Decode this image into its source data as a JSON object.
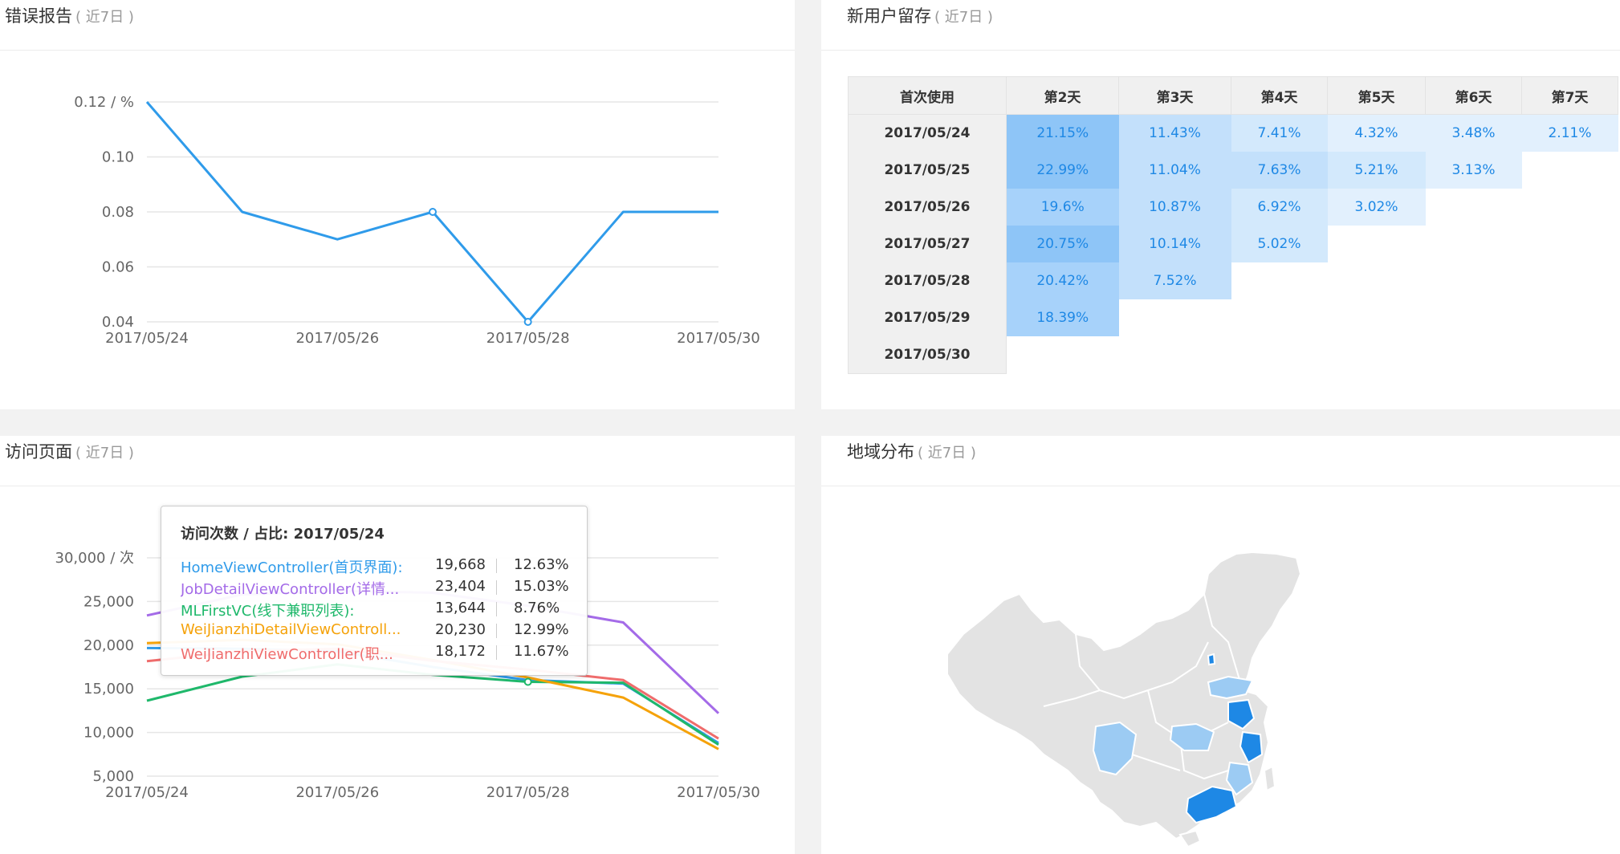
{
  "panels": {
    "error": {
      "title": "错误报告",
      "subtitle": "( 近7日 )"
    },
    "retention": {
      "title": "新用户留存",
      "subtitle": "( 近7日 )"
    },
    "visits": {
      "title": "访问页面",
      "subtitle": "( 近7日 )"
    },
    "region": {
      "title": "地域分布",
      "subtitle": "( 近7日 )"
    }
  },
  "chart_data": [
    {
      "type": "line",
      "title": "错误报告",
      "x": [
        "2017/05/24",
        "2017/05/25",
        "2017/05/26",
        "2017/05/27",
        "2017/05/28",
        "2017/05/29",
        "2017/05/30"
      ],
      "x_tick_labels": [
        "2017/05/24",
        "2017/05/26",
        "2017/05/28",
        "2017/05/30"
      ],
      "series": [
        {
          "values": [
            0.12,
            0.08,
            0.07,
            0.08,
            0.04,
            0.08,
            0.08
          ],
          "color": "#2f9bea"
        }
      ],
      "y_tick_labels": [
        "0.12 / %",
        "0.10",
        "0.08",
        "0.06",
        "0.04"
      ],
      "ylim": [
        0.04,
        0.12
      ],
      "grid": true
    },
    {
      "type": "line",
      "title": "访问页面",
      "x": [
        "2017/05/24",
        "2017/05/25",
        "2017/05/26",
        "2017/05/27",
        "2017/05/28",
        "2017/05/29",
        "2017/05/30"
      ],
      "x_tick_labels": [
        "2017/05/24",
        "2017/05/26",
        "2017/05/28",
        "2017/05/30"
      ],
      "y_tick_labels": [
        "30,000 / 次",
        "25,000",
        "20,000",
        "15,000",
        "10,000",
        "5,000"
      ],
      "ylim": [
        5000,
        30000
      ],
      "grid": true,
      "series": [
        {
          "name": "HomeViewController(首页界面)",
          "color": "#2f9bea",
          "values": [
            19668,
            19600,
            19300,
            17500,
            16000,
            15600,
            8800
          ]
        },
        {
          "name": "JobDetailViewController(详情...",
          "color": "#a46be8",
          "values": [
            23404,
            25800,
            26200,
            26000,
            24500,
            22600,
            12200
          ]
        },
        {
          "name": "MLFirstVC(线下兼职列表)",
          "color": "#1fb86b",
          "values": [
            13644,
            16400,
            17800,
            16600,
            15800,
            15700,
            8600
          ]
        },
        {
          "name": "WeiJianzhiDetailViewControll...",
          "color": "#f5a20a",
          "values": [
            20230,
            20600,
            20100,
            18300,
            16300,
            14000,
            8100
          ]
        },
        {
          "name": "WeiJianzhiViewController(职...",
          "color": "#ef6c6c",
          "values": [
            18172,
            19300,
            19600,
            18200,
            17200,
            16000,
            9300
          ]
        }
      ]
    }
  ],
  "retention": {
    "headers": [
      "首次使用",
      "第2天",
      "第3天",
      "第4天",
      "第5天",
      "第6天",
      "第7天"
    ],
    "rows": [
      {
        "date": "2017/05/24",
        "values": [
          "21.15%",
          "11.43%",
          "7.41%",
          "4.32%",
          "3.48%",
          "2.11%"
        ]
      },
      {
        "date": "2017/05/25",
        "values": [
          "22.99%",
          "11.04%",
          "7.63%",
          "5.21%",
          "3.13%"
        ]
      },
      {
        "date": "2017/05/26",
        "values": [
          "19.6%",
          "10.87%",
          "6.92%",
          "3.02%"
        ]
      },
      {
        "date": "2017/05/27",
        "values": [
          "20.75%",
          "10.14%",
          "5.02%"
        ]
      },
      {
        "date": "2017/05/28",
        "values": [
          "20.42%",
          "7.52%"
        ]
      },
      {
        "date": "2017/05/29",
        "values": [
          "18.39%"
        ]
      },
      {
        "date": "2017/05/30",
        "values": []
      }
    ]
  },
  "tooltip": {
    "title": "访问次数 / 占比: 2017/05/24",
    "rows": [
      {
        "name": "HomeViewController(首页界面):",
        "count": "19,668",
        "pct": "12.63%",
        "color": "#2f9bea"
      },
      {
        "name": "JobDetailViewController(详情...",
        "count": "23,404",
        "pct": "15.03%",
        "color": "#a46be8"
      },
      {
        "name": "MLFirstVC(线下兼职列表):",
        "count": "13,644",
        "pct": "8.76%",
        "color": "#1fb86b"
      },
      {
        "name": "WeiJianzhiDetailViewControll...",
        "count": "20,230",
        "pct": "12.99%",
        "color": "#f5a20a"
      },
      {
        "name": "WeiJianzhiViewController(职...",
        "count": "18,172",
        "pct": "11.67%",
        "color": "#ef6c6c"
      }
    ]
  },
  "map": {
    "base_color": "#e3e3e3",
    "highlight_colors": {
      "strong": "#1e88e5",
      "light": "#9ccbf3"
    }
  }
}
